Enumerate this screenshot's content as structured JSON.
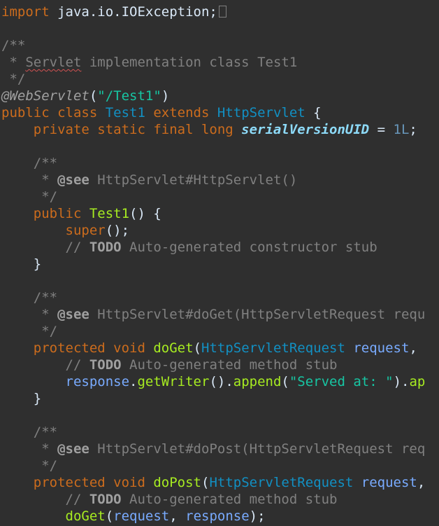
{
  "colors": {
    "background": "#2f2f2f",
    "plain": "#d9e8f7",
    "keyword": "#cc6c1d",
    "comment": "#808080",
    "javadoc_tag": "#a0a0a0",
    "todo": "#a0a0a0",
    "annotation": "#a0a0a0",
    "string": "#17c6a3",
    "class_decl": "#1290c3",
    "type": "#1290c3",
    "method": "#a7ec21",
    "variable": "#79abff",
    "number": "#6897bb",
    "field": "#8ddaf8",
    "spell_error": "#d25252"
  },
  "editor": {
    "language": "java",
    "lines": [
      {
        "tokens": [
          {
            "text": "import",
            "c": "keyword"
          },
          {
            "text": " java.io.IOException;",
            "c": "plain"
          }
        ],
        "cursor": true
      },
      {
        "tokens": []
      },
      {
        "tokens": [
          {
            "text": "/**",
            "c": "comment"
          }
        ]
      },
      {
        "tokens": [
          {
            "text": " * ",
            "c": "comment"
          },
          {
            "text": "Servlet",
            "c": "comment",
            "squiggle": true
          },
          {
            "text": " implementation class Test1",
            "c": "comment"
          }
        ]
      },
      {
        "tokens": [
          {
            "text": " */",
            "c": "comment"
          }
        ]
      },
      {
        "tokens": [
          {
            "text": "@WebServlet",
            "c": "annotation",
            "italic": true
          },
          {
            "text": "(",
            "c": "plain"
          },
          {
            "text": "\"/Test1\"",
            "c": "string"
          },
          {
            "text": ")",
            "c": "plain"
          }
        ]
      },
      {
        "tokens": [
          {
            "text": "public class ",
            "c": "keyword"
          },
          {
            "text": "Test1",
            "c": "class_decl"
          },
          {
            "text": " extends ",
            "c": "keyword"
          },
          {
            "text": "HttpServlet",
            "c": "type"
          },
          {
            "text": " {",
            "c": "plain"
          }
        ]
      },
      {
        "tokens": [
          {
            "text": "    private static final long ",
            "c": "keyword"
          },
          {
            "text": "serialVersionUID",
            "c": "field",
            "italic": true,
            "bold": true
          },
          {
            "text": " = ",
            "c": "plain"
          },
          {
            "text": "1L",
            "c": "number"
          },
          {
            "text": ";",
            "c": "plain"
          }
        ]
      },
      {
        "tokens": []
      },
      {
        "tokens": [
          {
            "text": "    /**",
            "c": "comment"
          }
        ]
      },
      {
        "tokens": [
          {
            "text": "     * ",
            "c": "comment"
          },
          {
            "text": "@see",
            "c": "javadoc_tag",
            "bold": true
          },
          {
            "text": " HttpServlet#HttpServlet()",
            "c": "comment"
          }
        ]
      },
      {
        "tokens": [
          {
            "text": "     */",
            "c": "comment"
          }
        ]
      },
      {
        "tokens": [
          {
            "text": "    public ",
            "c": "keyword"
          },
          {
            "text": "Test1",
            "c": "method"
          },
          {
            "text": "() {",
            "c": "plain"
          }
        ]
      },
      {
        "tokens": [
          {
            "text": "        super",
            "c": "keyword"
          },
          {
            "text": "();",
            "c": "plain"
          }
        ]
      },
      {
        "tokens": [
          {
            "text": "        // ",
            "c": "comment"
          },
          {
            "text": "TODO",
            "c": "todo",
            "bold": true
          },
          {
            "text": " Auto-generated constructor stub",
            "c": "comment"
          }
        ]
      },
      {
        "tokens": [
          {
            "text": "    }",
            "c": "plain"
          }
        ]
      },
      {
        "tokens": []
      },
      {
        "tokens": [
          {
            "text": "    /**",
            "c": "comment"
          }
        ]
      },
      {
        "tokens": [
          {
            "text": "     * ",
            "c": "comment"
          },
          {
            "text": "@see",
            "c": "javadoc_tag",
            "bold": true
          },
          {
            "text": " HttpServlet#doGet(HttpServletRequest requ",
            "c": "comment"
          }
        ]
      },
      {
        "tokens": [
          {
            "text": "     */",
            "c": "comment"
          }
        ]
      },
      {
        "tokens": [
          {
            "text": "    protected void ",
            "c": "keyword"
          },
          {
            "text": "doGet",
            "c": "method"
          },
          {
            "text": "(",
            "c": "plain"
          },
          {
            "text": "HttpServletRequest",
            "c": "type"
          },
          {
            "text": " ",
            "c": "plain"
          },
          {
            "text": "request",
            "c": "variable"
          },
          {
            "text": ",",
            "c": "plain"
          }
        ]
      },
      {
        "tokens": [
          {
            "text": "        // ",
            "c": "comment"
          },
          {
            "text": "TODO",
            "c": "todo",
            "bold": true
          },
          {
            "text": " Auto-generated method stub",
            "c": "comment"
          }
        ]
      },
      {
        "tokens": [
          {
            "text": "        response",
            "c": "variable"
          },
          {
            "text": ".",
            "c": "plain"
          },
          {
            "text": "getWriter",
            "c": "method"
          },
          {
            "text": "().",
            "c": "plain"
          },
          {
            "text": "append",
            "c": "method"
          },
          {
            "text": "(",
            "c": "plain"
          },
          {
            "text": "\"Served at: \"",
            "c": "string"
          },
          {
            "text": ").",
            "c": "plain"
          },
          {
            "text": "ap",
            "c": "method"
          }
        ]
      },
      {
        "tokens": [
          {
            "text": "    }",
            "c": "plain"
          }
        ]
      },
      {
        "tokens": []
      },
      {
        "tokens": [
          {
            "text": "    /**",
            "c": "comment"
          }
        ]
      },
      {
        "tokens": [
          {
            "text": "     * ",
            "c": "comment"
          },
          {
            "text": "@see",
            "c": "javadoc_tag",
            "bold": true
          },
          {
            "text": " HttpServlet#doPost(HttpServletRequest req",
            "c": "comment"
          }
        ]
      },
      {
        "tokens": [
          {
            "text": "     */",
            "c": "comment"
          }
        ]
      },
      {
        "tokens": [
          {
            "text": "    protected void ",
            "c": "keyword"
          },
          {
            "text": "doPost",
            "c": "method"
          },
          {
            "text": "(",
            "c": "plain"
          },
          {
            "text": "HttpServletRequest",
            "c": "type"
          },
          {
            "text": " ",
            "c": "plain"
          },
          {
            "text": "request",
            "c": "variable"
          },
          {
            "text": ",",
            "c": "plain"
          }
        ]
      },
      {
        "tokens": [
          {
            "text": "        // ",
            "c": "comment"
          },
          {
            "text": "TODO",
            "c": "todo",
            "bold": true
          },
          {
            "text": " Auto-generated method stub",
            "c": "comment"
          }
        ]
      },
      {
        "tokens": [
          {
            "text": "        doGet",
            "c": "method"
          },
          {
            "text": "(",
            "c": "plain"
          },
          {
            "text": "request",
            "c": "variable"
          },
          {
            "text": ", ",
            "c": "plain"
          },
          {
            "text": "response",
            "c": "variable"
          },
          {
            "text": ");",
            "c": "plain"
          }
        ]
      }
    ]
  }
}
